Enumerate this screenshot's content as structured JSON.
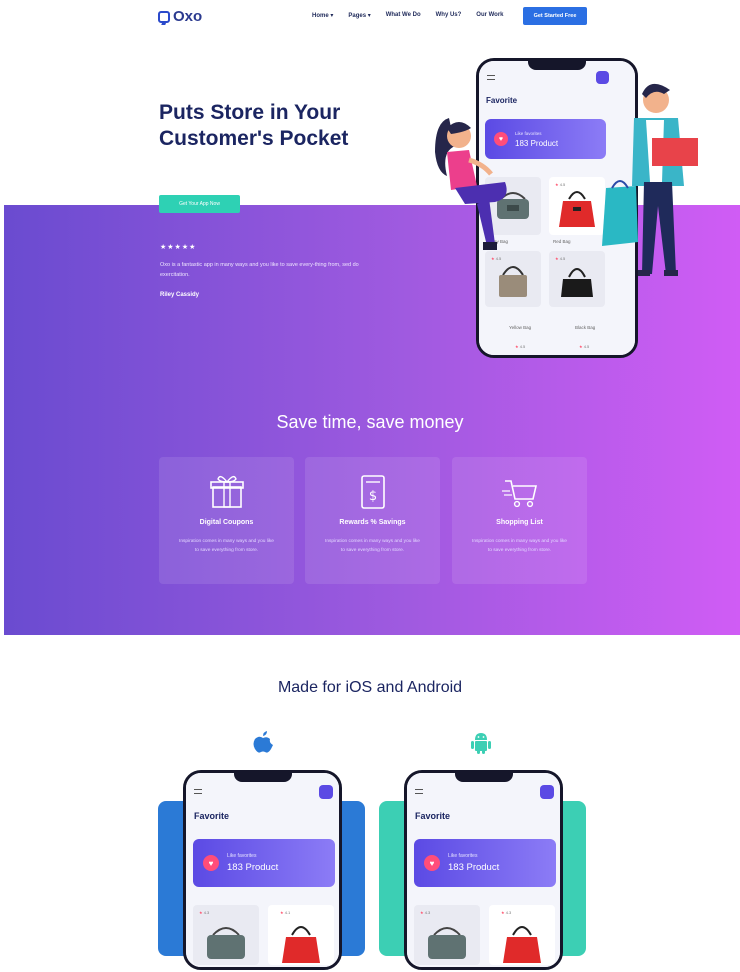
{
  "nav": {
    "logo": "Oxo",
    "items": [
      "Home ▾",
      "Pages ▾",
      "What We Do",
      "Why Us?",
      "Our Work"
    ],
    "cta": "Get Started Free"
  },
  "hero": {
    "title": "Puts Store in Your Customer's Pocket",
    "button": "Get Your App Now",
    "rating_stars": "★★★★★",
    "quote": "Oxo is a fantastic app in many ways and you like to save every-thing from, sed do exercitation.",
    "author": "Riley Cassidy"
  },
  "phone": {
    "title": "Favorite",
    "fav_label": "Like favorites",
    "fav_count": "183 Product",
    "ratings": [
      "4.9",
      "4.5",
      "4.5",
      "4.5",
      "4.5"
    ],
    "labels": [
      "Gray Bag",
      "Red Bag",
      "Yellow Bag",
      "Black Bag"
    ]
  },
  "features": {
    "title": "Save time, save money",
    "cards": [
      {
        "title": "Digital Coupons",
        "desc": "Inspiration comes in many ways and you like to save everything from store."
      },
      {
        "title": "Rewards % Savings",
        "desc": "Inspiration comes in many ways and you like to save everything from store."
      },
      {
        "title": "Shopping List",
        "desc": "Inspiration comes in many ways and you like to save everything from store."
      }
    ]
  },
  "platforms": {
    "title": "Made for iOS and Android",
    "ios_color": "#2b7ad6",
    "android_color": "#3ccfb4",
    "phones": [
      {
        "title": "Favorite",
        "fav_label": "Like favorites",
        "fav_count": "183 Product",
        "r1": "4.3",
        "r2": "4.1"
      },
      {
        "title": "Favorite",
        "fav_label": "Like favorites",
        "fav_count": "183 Product",
        "r1": "4.3",
        "r2": "4.3"
      }
    ]
  }
}
